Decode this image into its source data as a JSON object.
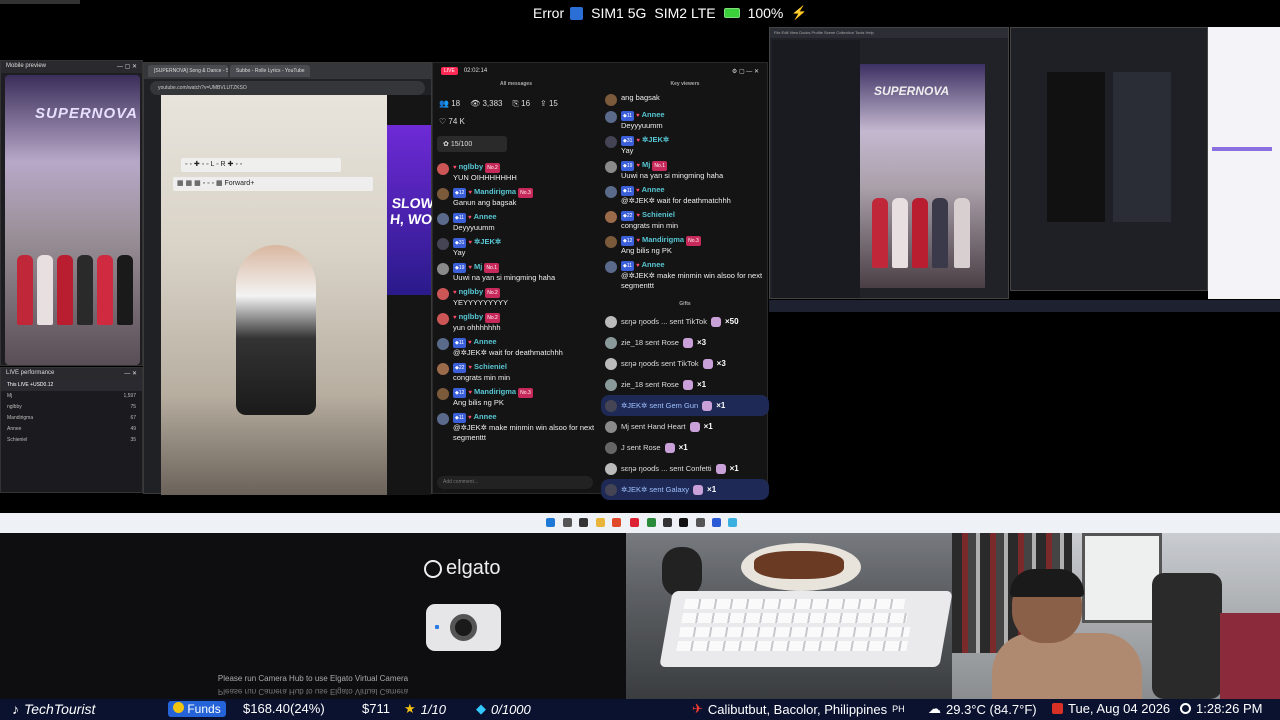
{
  "status_bar": {
    "error_label": "Error",
    "sim1": "SIM1 5G",
    "sim2": "SIM2 LTE",
    "battery": "100%"
  },
  "mobile_preview": {
    "title": "Mobile preview",
    "logo": "SUPERNOVA"
  },
  "live_performance": {
    "title": "LIVE performance",
    "summary": "This LIVE +USD0.12",
    "rows": [
      {
        "name": "Mj",
        "value": "1,597"
      },
      {
        "name": "nglbby",
        "value": "75"
      },
      {
        "name": "Mandirigma",
        "value": "67"
      },
      {
        "name": "Annee",
        "value": "49"
      },
      {
        "name": "Schieniel",
        "value": "35"
      }
    ]
  },
  "browser": {
    "tabs": [
      "[SUPERNOVA] Song & Dance - Sxs",
      "Subbo - Rolle Lyrics - YouTube"
    ],
    "url": "youtube.com/watch?v=UMBVLUTZKSO",
    "side_text": "SLOW\nH, WOAH",
    "emoji_bar_right": "Forward+"
  },
  "live_chat": {
    "time": "02:02:14",
    "all_messages_label": "All messages",
    "key_viewers_label": "Key viewers",
    "gifts_label": "Gifts",
    "stats": {
      "viewers": "18",
      "count": "3,383",
      "shares": "16",
      "gifts": "15"
    },
    "likes": "74 K",
    "goal": "15/100",
    "comment_placeholder": "Add comment...",
    "messages": [
      {
        "user": "nglbby",
        "lvl": "",
        "no": "No.2",
        "text": "YUN OIHHHHHHH",
        "color": "#c55"
      },
      {
        "user": "Mandirigma",
        "lvl": "12",
        "no": "No.3",
        "text": "Ganun ang bagsak",
        "color": "#7a5a3a"
      },
      {
        "user": "Annee",
        "lvl": "11",
        "no": "",
        "text": "Deyyyuumm",
        "color": "#5a6a8a"
      },
      {
        "user": "✲JEK✲",
        "lvl": "31",
        "no": "",
        "text": "Yay",
        "color": "#445"
      },
      {
        "user": "Mj",
        "lvl": "19",
        "no": "No.1",
        "text": "Uuwi na yan si mingming haha",
        "color": "#8a8a8a"
      },
      {
        "user": "nglbby",
        "lvl": "",
        "no": "No.2",
        "text": "YEYYYYYYYYY",
        "color": "#c55"
      },
      {
        "user": "nglbby",
        "lvl": "",
        "no": "No.2",
        "text": "yun ohhhhhhh",
        "color": "#c55"
      },
      {
        "user": "Annee",
        "lvl": "11",
        "no": "",
        "text": "@✲JEK✲ wait for deathmatchhh",
        "color": "#5a6a8a"
      },
      {
        "user": "Schieniel",
        "lvl": "22",
        "no": "",
        "text": "congrats min min",
        "color": "#9a6a4a"
      },
      {
        "user": "Mandirigma",
        "lvl": "12",
        "no": "No.3",
        "text": "Ang bilis ng PK",
        "color": "#7a5a3a"
      },
      {
        "user": "Annee",
        "lvl": "11",
        "no": "",
        "text": "@✲JEK✲ make minmin win alsoo for next segmenttt",
        "color": "#5a6a8a"
      }
    ],
    "key_messages": [
      {
        "user": "",
        "lvl": "",
        "no": "",
        "text": "ang bagsak",
        "color": "#7a5a3a"
      },
      {
        "user": "Annee",
        "lvl": "11",
        "no": "",
        "text": "Deyyyuumm",
        "color": "#5a6a8a"
      },
      {
        "user": "✲JEK✲",
        "lvl": "31",
        "no": "",
        "text": "Yay",
        "color": "#445"
      },
      {
        "user": "Mj",
        "lvl": "19",
        "no": "No.1",
        "text": "Uuwi na yan si mingming haha",
        "color": "#8a8a8a"
      },
      {
        "user": "Annee",
        "lvl": "11",
        "no": "",
        "text": "@✲JEK✲ wait for deathmatchhh",
        "color": "#5a6a8a"
      },
      {
        "user": "Schieniel",
        "lvl": "22",
        "no": "",
        "text": "congrats min min",
        "color": "#9a6a4a"
      },
      {
        "user": "Mandirigma",
        "lvl": "12",
        "no": "No.3",
        "text": "Ang bilis ng PK",
        "color": "#7a5a3a"
      },
      {
        "user": "Annee",
        "lvl": "11",
        "no": "",
        "text": "@✲JEK✲ make minmin win alsoo for next segmenttt",
        "color": "#5a6a8a"
      }
    ],
    "gifts": [
      {
        "text": "sɛŋǝ ŋooɗs ... sent TikTok",
        "count": "×50",
        "highlight": false,
        "color": "#bbb"
      },
      {
        "text": "zie_18 sent Rose",
        "count": "×3",
        "highlight": false,
        "color": "#8a9a9a"
      },
      {
        "text": "sɛŋǝ ŋooɗs sent TikTok",
        "count": "×3",
        "highlight": false,
        "color": "#bbb"
      },
      {
        "text": "zie_18 sent Rose",
        "count": "×1",
        "highlight": false,
        "color": "#8a9a9a"
      },
      {
        "text": "✲JEK✲ sent Gem Gun",
        "count": "×1",
        "highlight": true,
        "color": "#445"
      },
      {
        "text": "Mj sent Hand Heart",
        "count": "×1",
        "highlight": false,
        "color": "#8a8a8a"
      },
      {
        "text": "J sent Rose",
        "count": "×1",
        "highlight": false,
        "color": "#666"
      },
      {
        "text": "sɛŋǝ ŋooɗs ... sent Confetti",
        "count": "×1",
        "highlight": false,
        "color": "#bbb"
      },
      {
        "text": "✲JEK✲ sent Galaxy",
        "count": "×1",
        "highlight": true,
        "color": "#445"
      }
    ]
  },
  "obs": {
    "logo": "SUPERNOVA"
  },
  "elgato": {
    "brand": "elgato",
    "message": "Please run Camera Hub to use Elgato Virtual Camera"
  },
  "ticker": {
    "channel": "TechTourist",
    "funds_label": "Funds",
    "funds_value": "$168.40(24%)",
    "amount": "$711",
    "stars": "1/10",
    "diamonds": "0/1000",
    "location": "Calibutbut, Bacolor, Philippines",
    "country": "PH",
    "weather": "29.3°C (84.7°F)",
    "date": "Tue, Aug 04 2026",
    "time": "1:28:26 PM"
  },
  "colors": {
    "ticker_bg": "#0b1230",
    "funds_blue": "#2463d8",
    "live_red": "#ff2a55",
    "username_teal": "#57c7d4"
  }
}
